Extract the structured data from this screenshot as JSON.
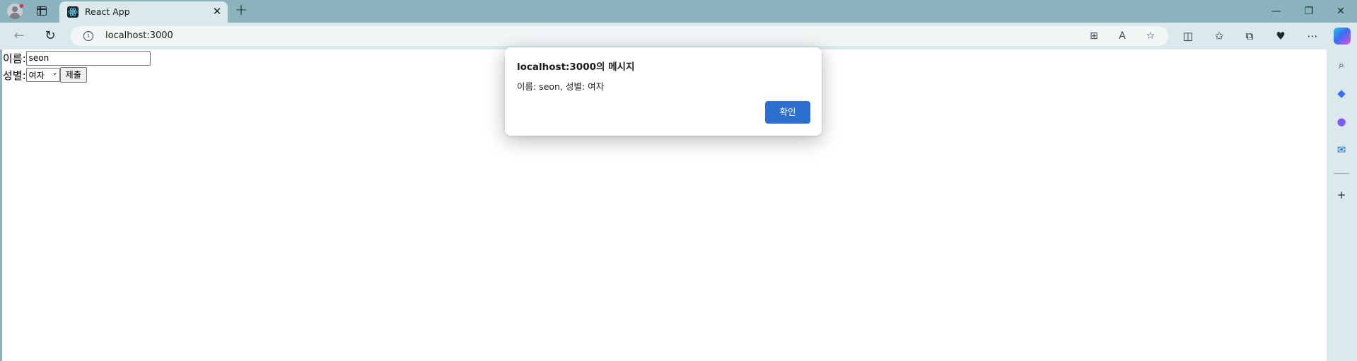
{
  "browser": {
    "tab": {
      "title": "React App"
    },
    "address": {
      "url": "localhost:3000"
    }
  },
  "form": {
    "name_label": "이름:",
    "name_value": "seon",
    "gender_label": "성별:",
    "gender_selected": "여자",
    "submit_label": "제출"
  },
  "dialog": {
    "title": "localhost:3000의 메시지",
    "message": "이름: seon, 성별: 여자",
    "ok_label": "확인"
  },
  "colors": {
    "chrome": "#8bb3be",
    "toolbar": "#dbe8ec",
    "ok_button": "#2c6fce"
  }
}
